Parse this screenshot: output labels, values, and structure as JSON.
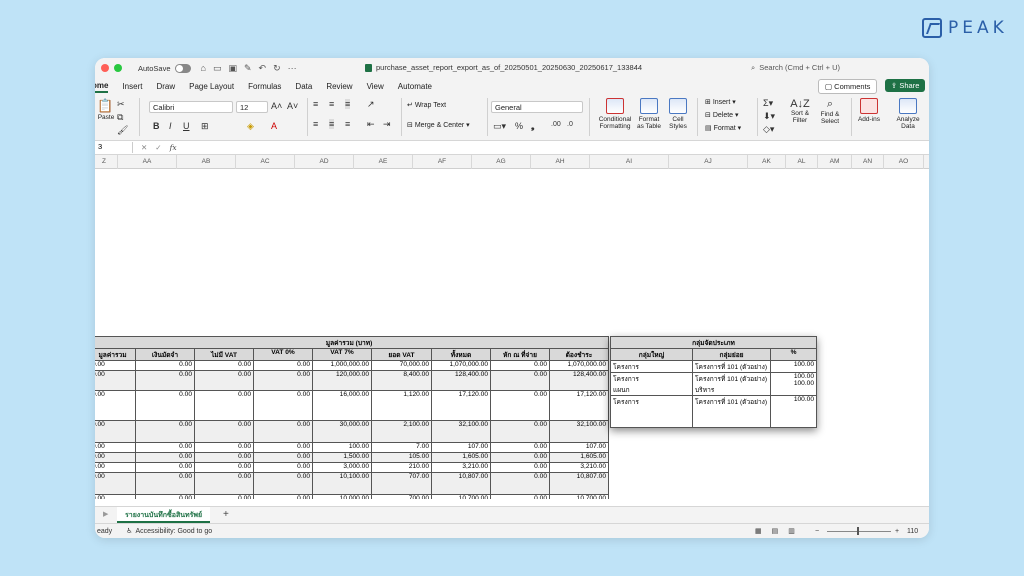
{
  "brand": {
    "text": "PEAK",
    "color": "#2b5fa8"
  },
  "titlebar": {
    "autosave_label": "AutoSave",
    "filename": "purchase_asset_report_export_as_of_20250501_20250630_20250617_133844",
    "search_placeholder": "Search (Cmd + Ctrl + U)"
  },
  "tabs": [
    "ome",
    "Insert",
    "Draw",
    "Page Layout",
    "Formulas",
    "Data",
    "Review",
    "View",
    "Automate"
  ],
  "comments_label": "Comments",
  "share_label": "Share",
  "ribbon": {
    "paste": "Paste",
    "font_name": "Calibri",
    "font_size": "12",
    "wrap_text": "Wrap Text",
    "merge_center": "Merge & Center",
    "number_format": "General",
    "conditional": "Conditional Formatting",
    "format_table": "Format as Table",
    "cell_styles": "Cell Styles",
    "insert": "Insert",
    "delete": "Delete",
    "format": "Format",
    "sort_filter": "Sort & Filter",
    "find_select": "Find & Select",
    "addins": "Add-ins",
    "analyze": "Analyze Data"
  },
  "formula_bar": {
    "name_box": "3",
    "fx": "fx"
  },
  "columns": [
    "Z",
    "AA",
    "AB",
    "AC",
    "AD",
    "AE",
    "AF",
    "AG",
    "AH",
    "AI",
    "AJ",
    "AK",
    "AL",
    "AM",
    "AN",
    "AO"
  ],
  "main_table": {
    "group_header": "มูลค่ารวม (บาท)",
    "headers": [
      "มูลค่ารวม",
      "เงินมัดจำ",
      "ไม่มี VAT",
      "VAT 0%",
      "VAT 7%",
      "ยอด VAT",
      "ทั้งหมด",
      "หัก ณ ที่จ่าย",
      "ต้องชำระ"
    ],
    "rows": [
      [
        "0.00",
        "0.00",
        "0.00",
        "0.00",
        "1,000,000.00",
        "70,000.00",
        "1,070,000.00",
        "0.00",
        "1,070,000.00"
      ],
      [
        "0.00",
        "0.00",
        "0.00",
        "0.00",
        "120,000.00",
        "8,400.00",
        "128,400.00",
        "0.00",
        "128,400.00"
      ],
      [
        "0.00",
        "0.00",
        "0.00",
        "0.00",
        "16,000.00",
        "1,120.00",
        "17,120.00",
        "0.00",
        "17,120.00"
      ],
      [
        "0.00",
        "0.00",
        "0.00",
        "0.00",
        "30,000.00",
        "2,100.00",
        "32,100.00",
        "0.00",
        "32,100.00"
      ],
      [
        "0.00",
        "0.00",
        "0.00",
        "0.00",
        "100.00",
        "7.00",
        "107.00",
        "0.00",
        "107.00"
      ],
      [
        "0.00",
        "0.00",
        "0.00",
        "0.00",
        "1,500.00",
        "105.00",
        "1,605.00",
        "0.00",
        "1,605.00"
      ],
      [
        "0.00",
        "0.00",
        "0.00",
        "0.00",
        "3,000.00",
        "210.00",
        "3,210.00",
        "0.00",
        "3,210.00"
      ],
      [
        "0.00",
        "0.00",
        "0.00",
        "0.00",
        "10,100.00",
        "707.00",
        "10,807.00",
        "0.00",
        "10,807.00"
      ],
      [
        "0.00",
        "0.00",
        "0.00",
        "0.00",
        "10,000.00",
        "700.00",
        "10,700.00",
        "0.00",
        "10,700.00"
      ]
    ],
    "total_label": "รวม",
    "total": [
      "0.00",
      "0.00",
      "0.00",
      "1,190,700.00",
      "83,349.00",
      "1,274,049.00",
      "0.00",
      "1,274,049.00"
    ]
  },
  "group_table": {
    "title": "กลุ่มจัดประเภท",
    "headers": [
      "กลุ่มใหญ่",
      "กลุ่มย่อย",
      "%"
    ],
    "rows": [
      [
        "โครงการ",
        "โครงการที่ 101 (ตัวอย่าง)",
        "100.00"
      ],
      [
        "โครงการ\nแผนก",
        "โครงการที่ 101 (ตัวอย่าง)\nบริหาร",
        "100.00\n100.00"
      ],
      [
        "โครงการ",
        "โครงการที่ 101 (ตัวอย่าง)",
        "100.00"
      ]
    ]
  },
  "sheet_tab": "รายงานบันทึกซื้อสินทรัพย์",
  "status": {
    "ready": "eady",
    "accessibility": "Accessibility: Good to go",
    "zoom": "110"
  }
}
